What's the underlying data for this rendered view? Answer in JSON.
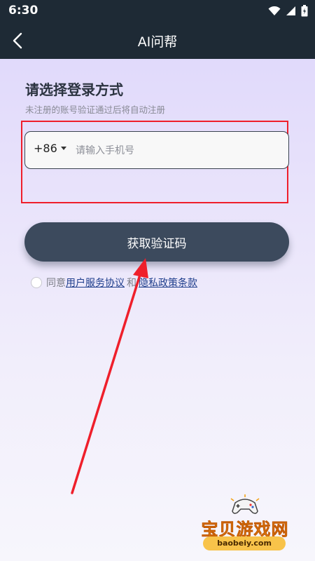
{
  "status_bar": {
    "time": "6:30"
  },
  "app_bar": {
    "title": "AI问帮"
  },
  "login": {
    "heading": "请选择登录方式",
    "subheading": "未注册的账号验证通过后将自动注册",
    "country_code": "+86",
    "phone_placeholder": "请输入手机号",
    "phone_value": "",
    "get_code_label": "获取验证码",
    "agree_prefix": "同意",
    "user_agreement": "用户服务协议",
    "agree_and": "和",
    "privacy_policy": "隐私政策条款",
    "agree_checked": false
  },
  "watermark": {
    "title": "宝贝游戏网",
    "url": "baobeiy.com"
  },
  "colors": {
    "header_bg": "#1e2a35",
    "button_bg": "#3c4a5d",
    "annotation_red": "#ef1f2b",
    "link": "#1f3e8c"
  }
}
